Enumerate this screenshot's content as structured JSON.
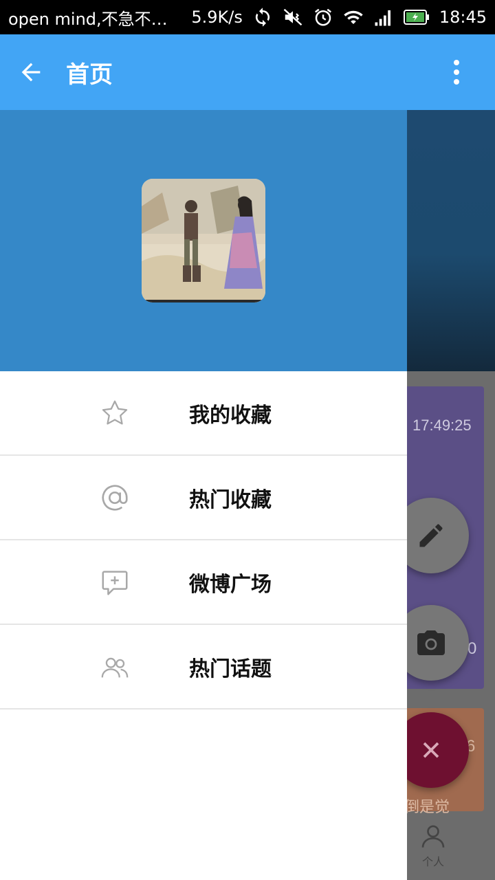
{
  "status_bar": {
    "notification": "open mind,不急不…",
    "speed": "5.9K/s",
    "time": "18:45",
    "icons": [
      "sync-icon",
      "mute-vibrate-icon",
      "alarm-icon",
      "wifi-icon",
      "signal-icon",
      "battery-icon"
    ]
  },
  "app_bar": {
    "title": "首页",
    "back_icon": "arrow-left-icon",
    "more_icon": "more-vert-icon",
    "color": "#42a5f5"
  },
  "drawer": {
    "header_color": "#3588c8",
    "items": [
      {
        "label": "我的收藏",
        "icon": "star-icon"
      },
      {
        "label": "热门收藏",
        "icon": "at-icon"
      },
      {
        "label": "微博广场",
        "icon": "comment-plus-icon"
      },
      {
        "label": "热门话题",
        "icon": "people-icon"
      }
    ]
  },
  "background": {
    "card1_time": "17:49:25",
    "card1_count": "0",
    "card2_count": "6",
    "card2_text": "我倒是觉",
    "bottom_tab_label": "个人",
    "fab_icons": [
      "pencil-icon",
      "camera-icon",
      "close-icon"
    ],
    "fab_close_color": "#6e1030"
  }
}
